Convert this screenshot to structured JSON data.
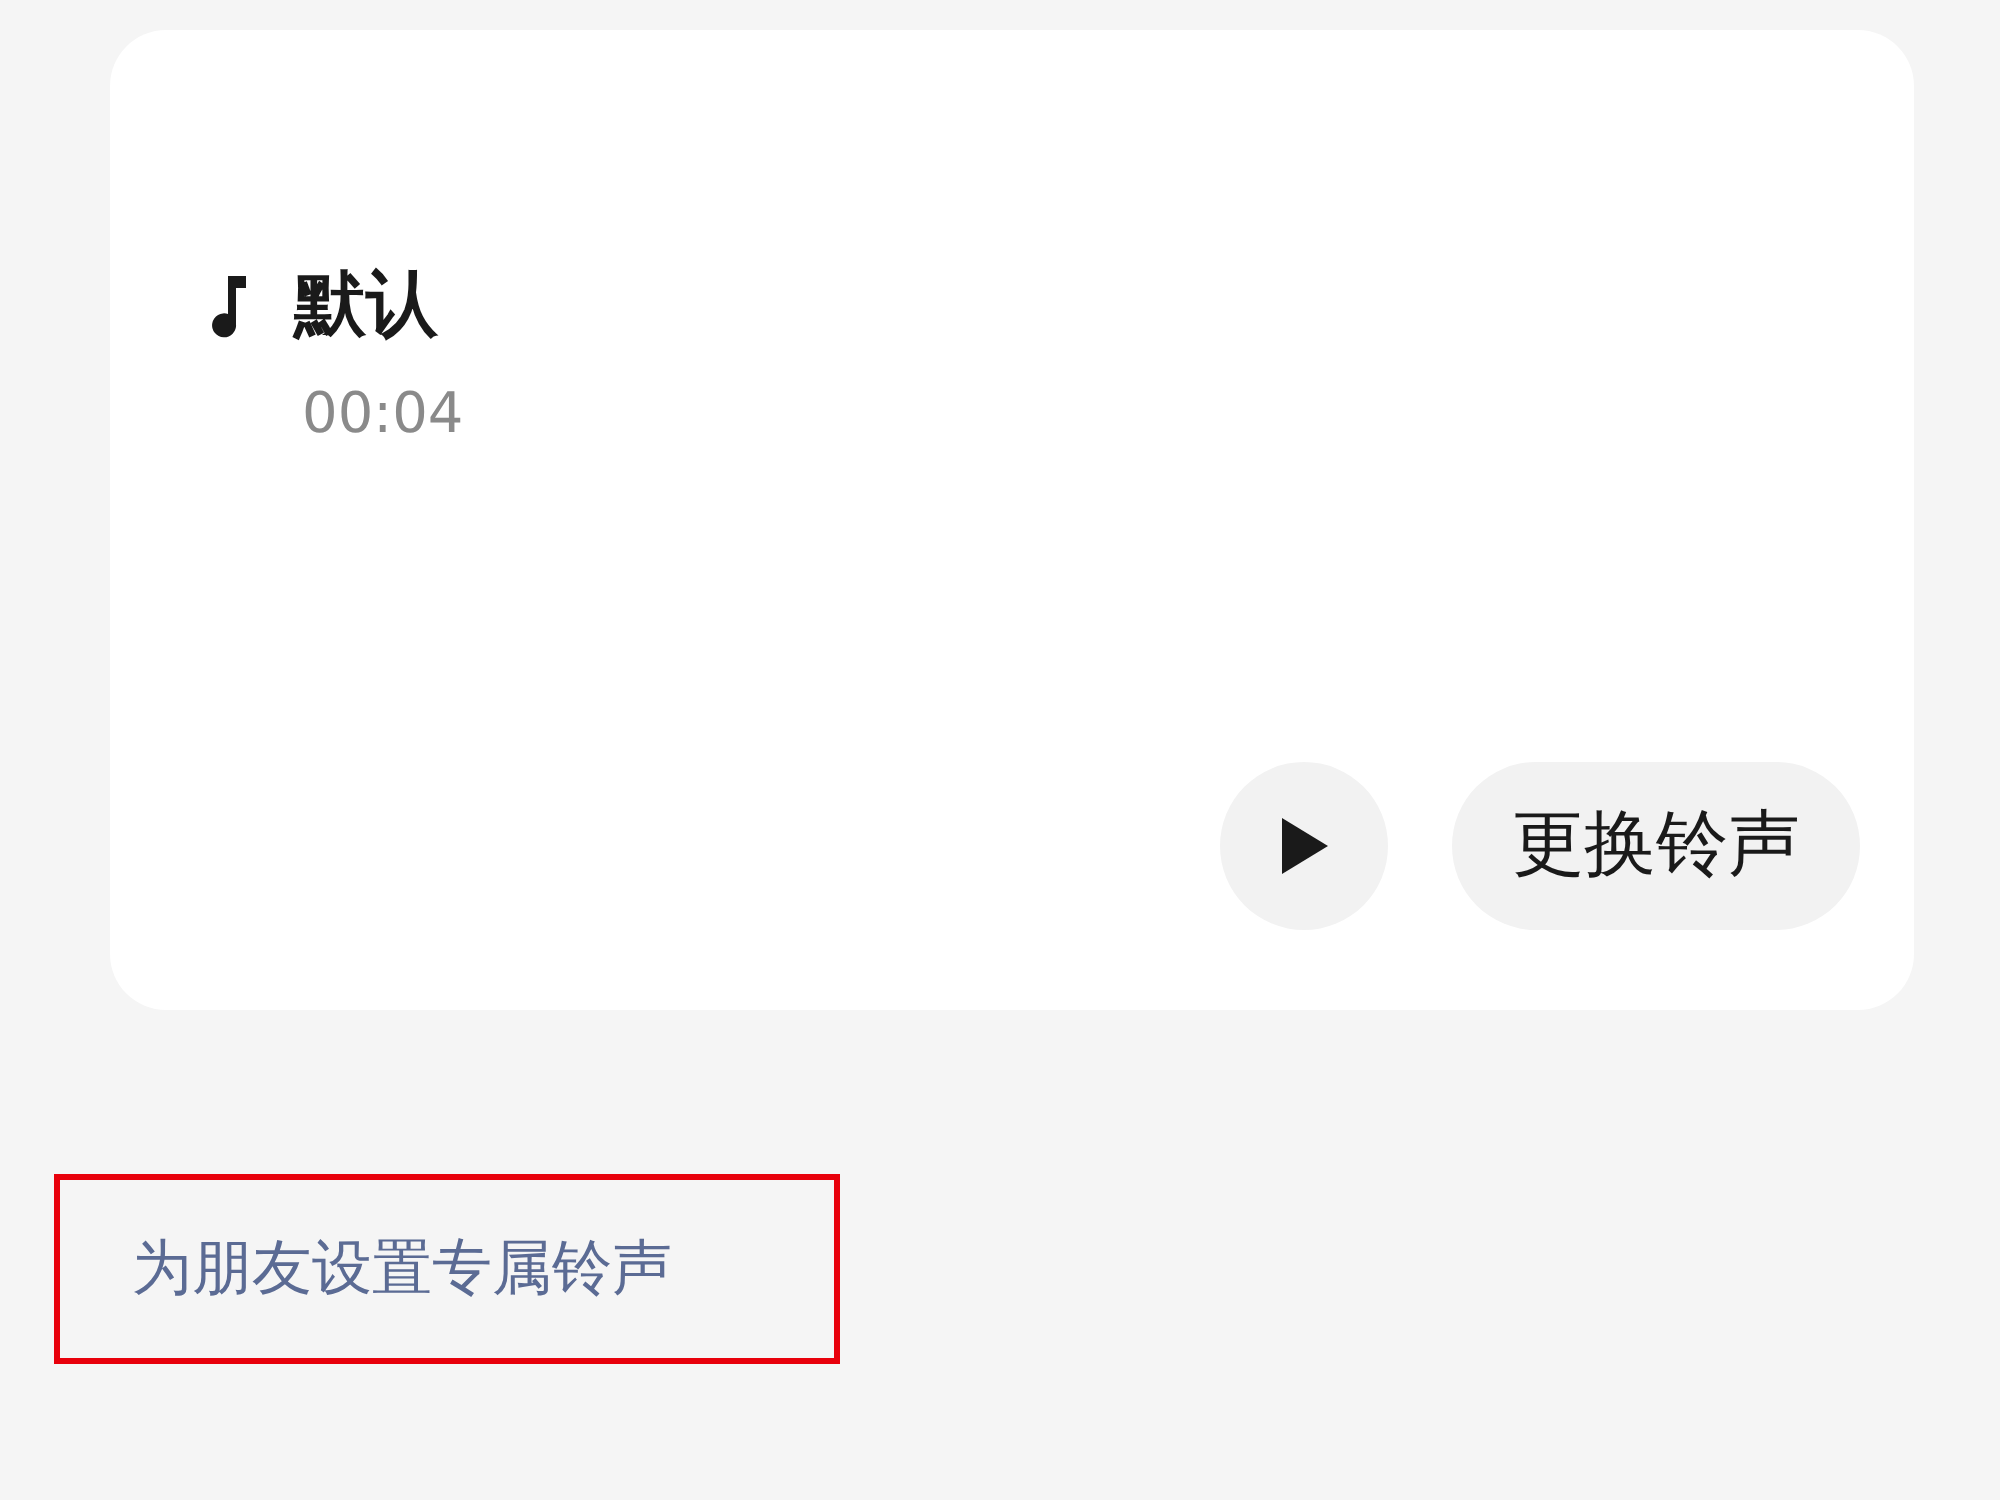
{
  "ringtone": {
    "title": "默认",
    "duration": "00:04"
  },
  "change_button": "更换铃声",
  "link": {
    "text": "为朋友设置专属铃声",
    "highlighted": true
  }
}
